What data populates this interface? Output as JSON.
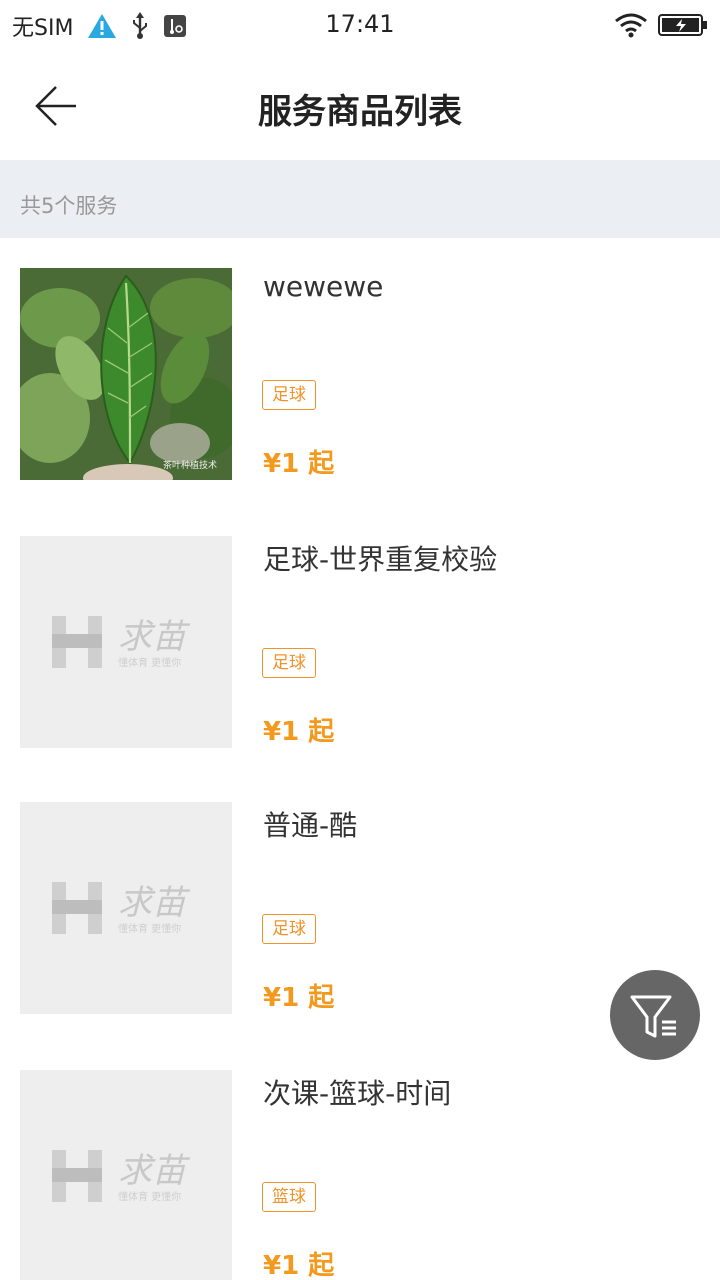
{
  "status_bar": {
    "carrier": "无SIM",
    "time": "17:41",
    "icons": [
      "warning-icon",
      "usb-icon",
      "usb-debug-icon",
      "wifi-icon",
      "battery-charging-icon"
    ]
  },
  "header": {
    "title": "服务商品列表",
    "back_icon": "arrow-left-icon"
  },
  "summary": {
    "count_text": "共5个服务"
  },
  "items": [
    {
      "title": "wewewe",
      "tag": "足球",
      "price": "¥1 起",
      "image": "tea-leaf-photo"
    },
    {
      "title": "足球-世界重复校验",
      "tag": "足球",
      "price": "¥1 起",
      "image": "placeholder-logo"
    },
    {
      "title": "普通-酷",
      "tag": "足球",
      "price": "¥1 起",
      "image": "placeholder-logo"
    },
    {
      "title": "次课-篮球-时间",
      "tag": "篮球",
      "price": "¥1 起",
      "image": "placeholder-logo"
    }
  ],
  "placeholder": {
    "brand": "求苗",
    "slogan": "懂体育 更懂你"
  },
  "photo_watermark": "茶叶种植技术",
  "filter_button": {
    "icon": "filter-list-icon"
  },
  "colors": {
    "accent": "#f39a1e",
    "tag_border": "#f0932b",
    "summary_bg": "#ebeef3",
    "fab_bg": "#666666"
  }
}
